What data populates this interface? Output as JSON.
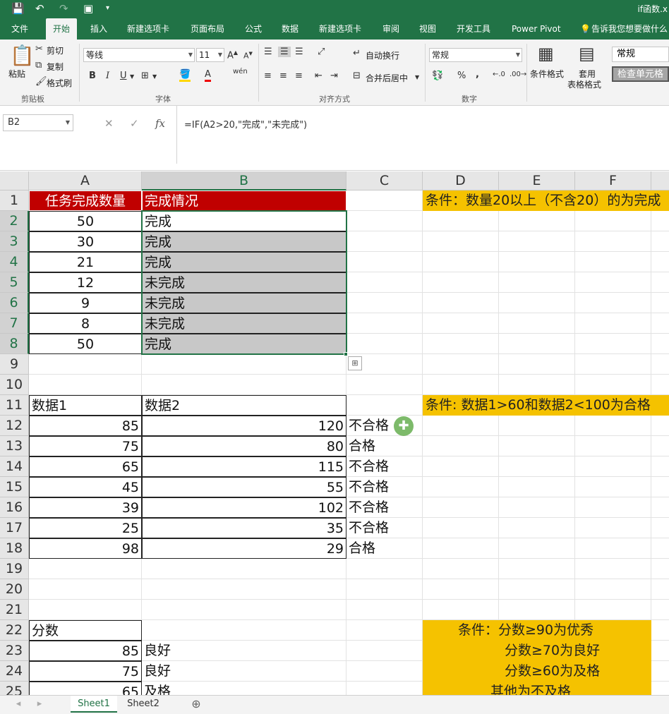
{
  "title": {
    "filename": "if函数.x"
  },
  "quick_access": {
    "save": "💾",
    "undo": "↶",
    "redo": "↷",
    "print_preview": "▣",
    "more": "▾"
  },
  "ribbon_tabs": [
    "文件",
    "开始",
    "插入",
    "新建选项卡",
    "页面布局",
    "公式",
    "数据",
    "新建选项卡",
    "审阅",
    "视图",
    "开发工具",
    "Power Pivot"
  ],
  "tell_me": "告诉我您想要做什么",
  "ribbon": {
    "paste": "粘贴",
    "cut": "剪切",
    "copy": "复制",
    "format_painter": "格式刷",
    "clipboard_group": "剪贴板",
    "font_name": "等线",
    "font_size": "11",
    "font_group": "字体",
    "bold": "B",
    "italic": "I",
    "underline": "U",
    "wen": "wén",
    "wrap_text": "自动换行",
    "merge_center": "合并后居中",
    "align_group": "对齐方式",
    "number_format": "常规",
    "number_group": "数字",
    "percent": "%",
    "comma": ",",
    "cond_format": "条件格式",
    "table_format_1": "套用",
    "table_format_2": "表格格式",
    "style_normal": "常规",
    "style_check": "检查单元格"
  },
  "formula_bar": {
    "name_box": "B2",
    "cancel": "✕",
    "enter": "✓",
    "fx": "fx",
    "formula": "=IF(A2>20,\"完成\",\"未完成\")"
  },
  "columns": [
    "A",
    "B",
    "C",
    "D",
    "E",
    "F"
  ],
  "rows": [
    "1",
    "2",
    "3",
    "4",
    "5",
    "6",
    "7",
    "8",
    "9",
    "10",
    "11",
    "12",
    "13",
    "14",
    "15",
    "16",
    "17",
    "18",
    "19",
    "20",
    "21",
    "22",
    "23",
    "24",
    "25"
  ],
  "table1": {
    "header_a": "任务完成数量",
    "header_b": "完成情况",
    "rows": [
      {
        "a": "50",
        "b": "完成"
      },
      {
        "a": "30",
        "b": "完成"
      },
      {
        "a": "21",
        "b": "完成"
      },
      {
        "a": "12",
        "b": "未完成"
      },
      {
        "a": "9",
        "b": "未完成"
      },
      {
        "a": "8",
        "b": "未完成"
      },
      {
        "a": "50",
        "b": "完成"
      }
    ]
  },
  "note1": "条件：数量20以上（不含20）的为完成",
  "table2": {
    "header_a": "数据1",
    "header_b": "数据2",
    "rows": [
      {
        "a": "85",
        "b": "120",
        "c": "不合格"
      },
      {
        "a": "75",
        "b": "80",
        "c": "合格"
      },
      {
        "a": "65",
        "b": "115",
        "c": "不合格"
      },
      {
        "a": "45",
        "b": "55",
        "c": "不合格"
      },
      {
        "a": "39",
        "b": "102",
        "c": "不合格"
      },
      {
        "a": "25",
        "b": "35",
        "c": "不合格"
      },
      {
        "a": "98",
        "b": "29",
        "c": "合格"
      }
    ]
  },
  "note2": "条件: 数据1>60和数据2<100为合格",
  "table3": {
    "header_a": "分数",
    "rows": [
      {
        "a": "85",
        "b": "良好"
      },
      {
        "a": "75",
        "b": "良好"
      },
      {
        "a": "65",
        "b": "及格"
      }
    ]
  },
  "note3": [
    "条件：分数≥90为优秀",
    "分数≥70为良好",
    "分数≥60为及格",
    "其他为不及格"
  ],
  "sheets": [
    "Sheet1",
    "Sheet2"
  ],
  "add_sheet": "⊕"
}
